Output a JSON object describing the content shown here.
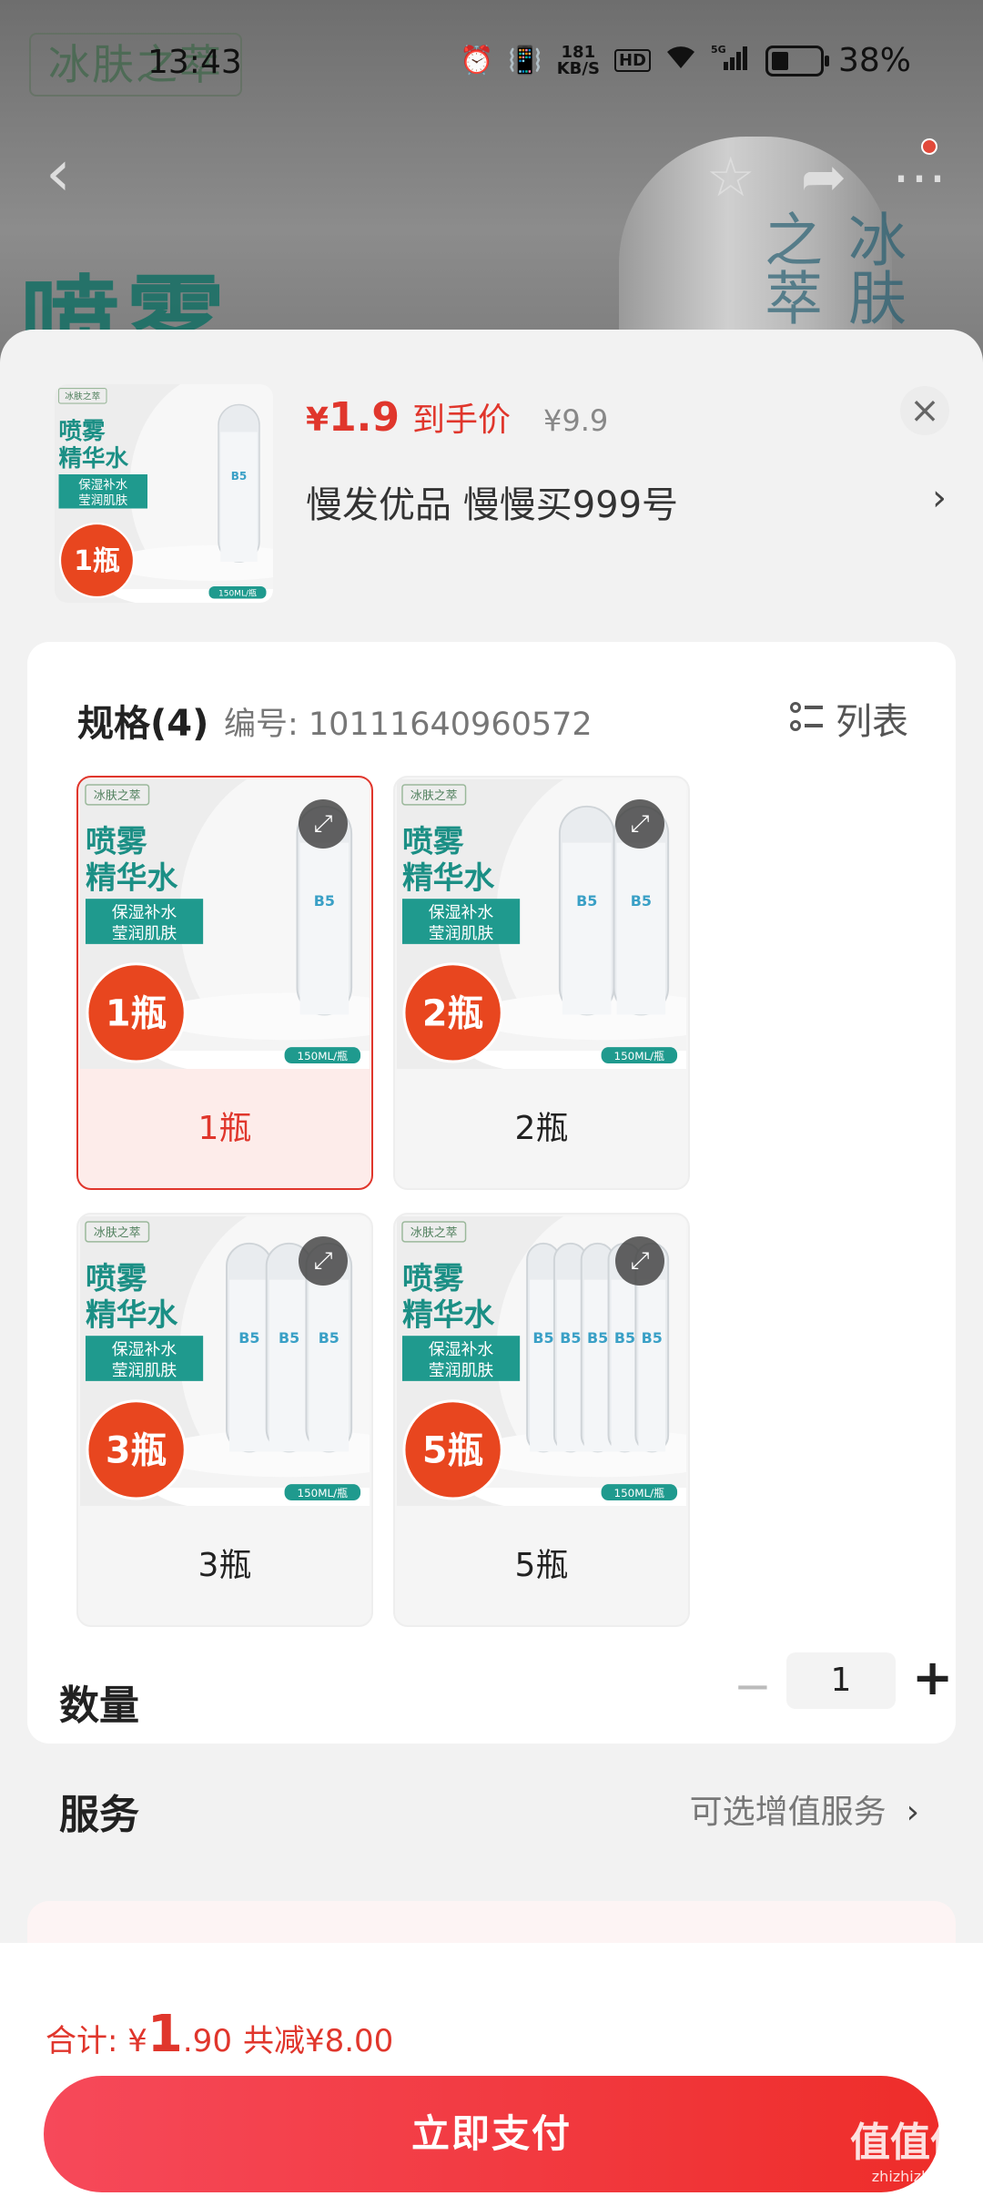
{
  "status_bar": {
    "time": "13:43",
    "net_speed": "181",
    "net_unit": "KB/S",
    "hd": "HD",
    "signal": "5G",
    "battery": "38%"
  },
  "background": {
    "logo": "冰肤之萃",
    "title": "喷雾",
    "bottle_text": "冰肤之萃"
  },
  "sheet": {
    "product": {
      "price_currency": "¥",
      "price_value": "1.9",
      "price_label": "到手价",
      "original_price": "¥9.9",
      "promo": "慢发优品  慢慢买999号"
    },
    "spec": {
      "title": "规格(4)",
      "code": "编号: 10111640960572",
      "list_label": "列表"
    },
    "options": [
      {
        "label": "1瓶",
        "badge": "1瓶",
        "selected": true,
        "bottles": 1
      },
      {
        "label": "2瓶",
        "badge": "2瓶",
        "selected": false,
        "bottles": 2
      },
      {
        "label": "3瓶",
        "badge": "3瓶",
        "selected": false,
        "bottles": 3
      },
      {
        "label": "5瓶",
        "badge": "5瓶",
        "selected": false,
        "bottles": 5
      }
    ],
    "product_image": {
      "brand": "冰肤之萃",
      "title_line1": "喷雾",
      "title_line2": "精华水",
      "benefit1": "保湿补水",
      "benefit2": "莹润肌肤",
      "volume": "150ML/瓶"
    },
    "quantity": {
      "label": "数量",
      "value": "1",
      "minus": "−",
      "plus": "+"
    },
    "service": {
      "label": "服务",
      "value": "可选增值服务"
    },
    "close_icon": "close-icon"
  },
  "footer": {
    "total_label": "合计: ",
    "total_currency": "¥",
    "total_int": "1",
    "total_dec": ".90",
    "savings": "共减¥8.00",
    "pay_button": "立即支付"
  },
  "watermark": {
    "text": "值值值",
    "sub": "zhizhizhi.com"
  },
  "colors": {
    "accent": "#e0362c",
    "teal": "#1f9a8e"
  }
}
